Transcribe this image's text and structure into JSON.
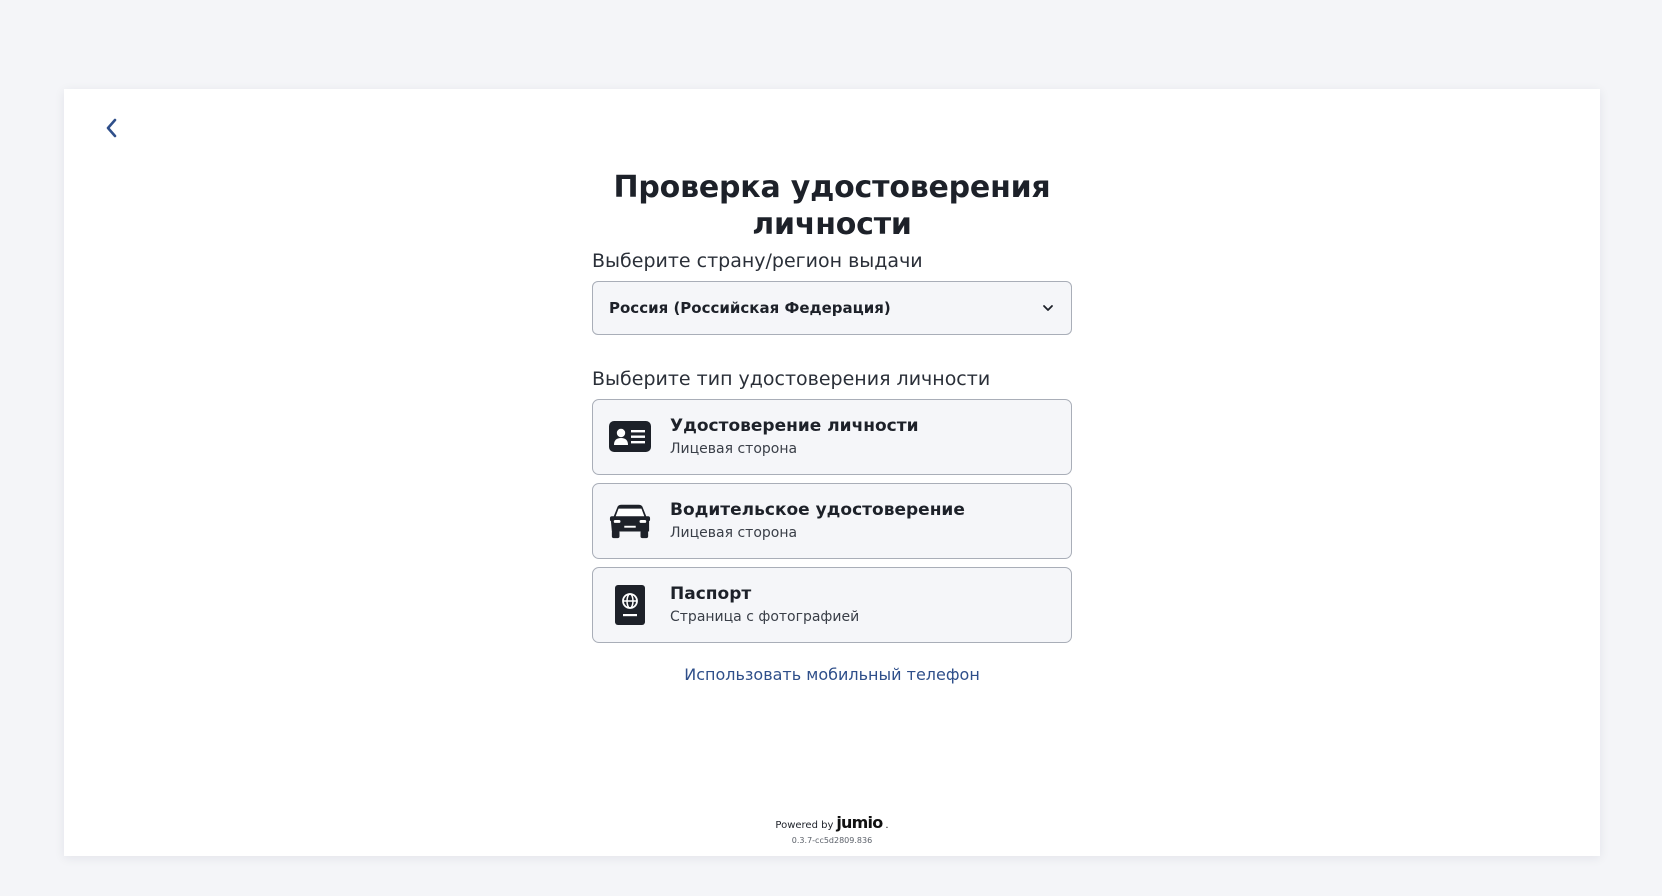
{
  "page": {
    "title": "Проверка удостоверения личности",
    "country_label": "Выберите страну/регион выдачи",
    "country_selected": "Россия (Российская Федерация)",
    "id_type_label": "Выберите тип удостоверения личности",
    "mobile_link": "Использовать мобильный телефон"
  },
  "options": [
    {
      "title": "Удостоверение личности",
      "subtitle": "Лицевая сторона",
      "icon": "id-card-icon"
    },
    {
      "title": "Водительское удостоверение",
      "subtitle": "Лицевая сторона",
      "icon": "car-icon"
    },
    {
      "title": "Паспорт",
      "subtitle": "Страница с фотографией",
      "icon": "passport-icon"
    }
  ],
  "footer": {
    "powered_by": "Powered by",
    "brand": "jumio",
    "version": "0.3.7-cc5d2809.836"
  },
  "icons": {
    "back": "chevron-left-icon",
    "dropdown": "chevron-down-icon"
  },
  "colors": {
    "accent": "#2f4f8a",
    "icon": "#1d2129",
    "background": "#f4f5f8",
    "card": "#ffffff"
  }
}
